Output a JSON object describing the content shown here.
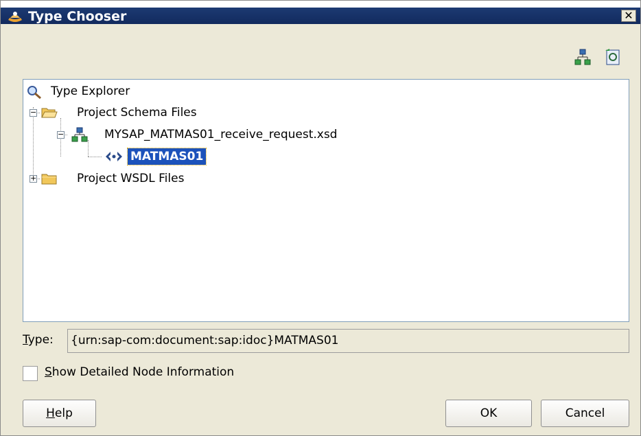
{
  "window": {
    "title": "Type Chooser",
    "close_label": "✕"
  },
  "toolbar": {
    "icons": [
      "hierarchy-icon",
      "import-schema-icon"
    ]
  },
  "tree": {
    "root": {
      "label": "Type Explorer"
    },
    "schema_folder": {
      "label": "Project Schema Files",
      "expanded": true
    },
    "xsd_file": {
      "label": "MYSAP_MATMAS01_receive_request.xsd",
      "expanded": true
    },
    "element": {
      "label": "MATMAS01",
      "selected": true
    },
    "wsdl_folder": {
      "label": "Project WSDL Files",
      "expanded": false
    }
  },
  "type_field": {
    "label_mnemonic": "T",
    "label_rest": "ype:",
    "value": "{urn:sap-com:document:sap:idoc}MATMAS01"
  },
  "options": {
    "show_detail_mnemonic": "S",
    "show_detail_rest": "how Detailed Node Information",
    "checked": false
  },
  "buttons": {
    "help_mnemonic": "H",
    "help_rest": "elp",
    "ok_label": "OK",
    "cancel_label": "Cancel"
  }
}
